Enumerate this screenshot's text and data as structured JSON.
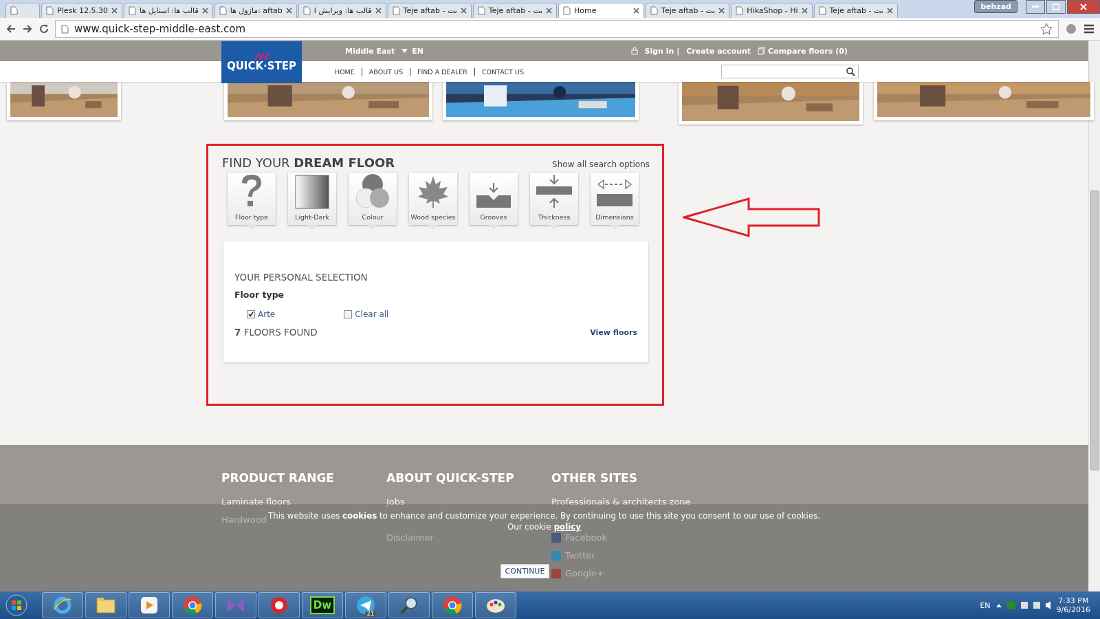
{
  "browser": {
    "tabs": [
      {
        "selected": false
      },
      {
        "title": "Plesk 12.5.30",
        "selected": false
      },
      {
        "title": "قالب ها: استایل ها",
        "selected": false
      },
      {
        "title": "ماژول ها: aftab",
        "selected": false
      },
      {
        "title": "قالب ها: ویرایش ا",
        "selected": false
      },
      {
        "title": "Teje aftab - ىت",
        "selected": false
      },
      {
        "title": "Teje aftab - ىت",
        "selected": false
      },
      {
        "title": "Home",
        "selected": true
      },
      {
        "title": "Teje aftab - ىت",
        "selected": false
      },
      {
        "title": "HikaShop - Hi",
        "selected": false
      },
      {
        "title": "Teje aftab - ىت",
        "selected": false
      }
    ],
    "user": "behzad",
    "url": "www.quick-step-middle-east.com"
  },
  "header": {
    "logo": "QUICK·STEP",
    "region": "Middle East",
    "language": "EN",
    "account_links": [
      "Sign in |",
      "Create account"
    ],
    "compare": "Compare floors (0)",
    "nav": [
      "HOME",
      "ABOUT US",
      "FIND A DEALER",
      "CONTACT US"
    ]
  },
  "finder": {
    "title_light": "FIND YOUR",
    "title_bold": "DREAM FLOOR",
    "show_all": "Show all search options",
    "filters": [
      {
        "label": "Floor type",
        "kind": "question"
      },
      {
        "label": "Light-Dark",
        "kind": "gradient"
      },
      {
        "label": "Colour",
        "kind": "circles"
      },
      {
        "label": "Wood species",
        "kind": "leaf"
      },
      {
        "label": "Grooves",
        "kind": "grooves"
      },
      {
        "label": "Thickness",
        "kind": "thickness"
      },
      {
        "label": "Dimensions",
        "kind": "dimensions"
      }
    ],
    "selection": {
      "title": "YOUR PERSONAL SELECTION",
      "group": "Floor type",
      "options": [
        {
          "label": "Arte",
          "checked": true
        },
        {
          "label": "Clear all",
          "checked": false
        }
      ],
      "count": "7",
      "found": "FLOORS FOUND",
      "view": "View floors"
    }
  },
  "footer": {
    "columns": [
      {
        "heading": "PRODUCT RANGE",
        "links": [
          "Laminate floors",
          "Hardwood"
        ]
      },
      {
        "heading": "ABOUT QUICK-STEP",
        "links": [
          "Jobs",
          "Disclaimer"
        ]
      },
      {
        "heading": "OTHER SITES",
        "links": [
          "Professionals & architects zone"
        ],
        "social": [
          "Facebook",
          "Twitter",
          "Google+"
        ]
      }
    ]
  },
  "cookie_banner": {
    "text": "This website uses **cookies** to enhance and customize your experience. By continuing to use this site you consent to our use of cookies.",
    "policy_prefix": "Our cookie",
    "policy_link": "policy",
    "button": "CONTINUE"
  },
  "taskbar": {
    "apps": [
      {
        "kind": "ie"
      },
      {
        "kind": "folder"
      },
      {
        "kind": "media"
      },
      {
        "kind": "chrome"
      },
      {
        "kind": "vs"
      },
      {
        "kind": "red"
      },
      {
        "kind": "dw",
        "label": "Dw"
      },
      {
        "kind": "telegram",
        "badge": "21"
      },
      {
        "kind": "search"
      },
      {
        "kind": "chrome"
      },
      {
        "kind": "paint"
      }
    ],
    "language": "EN",
    "time": "7:33 PM",
    "date": "9/6/2016"
  }
}
